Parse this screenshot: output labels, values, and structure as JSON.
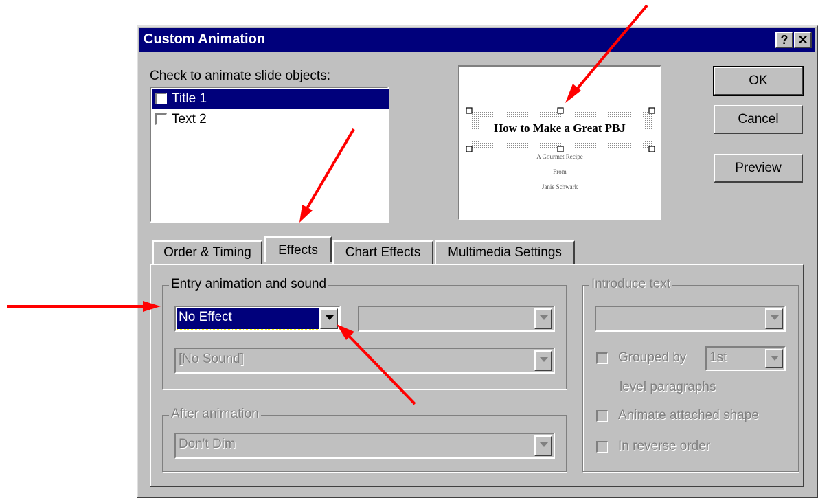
{
  "dialog": {
    "title": "Custom Animation",
    "help_button": "?",
    "close_button": "✕"
  },
  "objects": {
    "label": "Check to animate slide objects:",
    "items": [
      {
        "label": "Title 1",
        "checked": false,
        "selected": true
      },
      {
        "label": "Text 2",
        "checked": false,
        "selected": false
      }
    ]
  },
  "slide_preview": {
    "title": "How to Make a Great PBJ",
    "subtitle_lines": [
      "A Gourmet Recipe",
      "From",
      "Janie Schwark"
    ]
  },
  "buttons": {
    "ok": "OK",
    "cancel": "Cancel",
    "preview": "Preview"
  },
  "tabs": [
    {
      "label": "Order & Timing",
      "active": false
    },
    {
      "label": "Effects",
      "active": true
    },
    {
      "label": "Chart Effects",
      "active": false
    },
    {
      "label": "Multimedia Settings",
      "active": false
    }
  ],
  "entry_group": {
    "label": "Entry animation and sound",
    "effect_value": "No Effect",
    "direction_value": "",
    "sound_value": "[No Sound]"
  },
  "after_group": {
    "label": "After animation",
    "value": "Don't Dim"
  },
  "introduce_group": {
    "label": "Introduce text",
    "value": "",
    "grouped_by_label": "Grouped by",
    "grouped_by_value": "1st",
    "level_paragraphs": "level paragraphs",
    "animate_shape": "Animate attached shape",
    "reverse_order": "In reverse order"
  },
  "colors": {
    "titlebar": "#00007b",
    "selection": "#00007b",
    "face": "#c0c0c0",
    "annotation_arrow": "#ff0000"
  }
}
